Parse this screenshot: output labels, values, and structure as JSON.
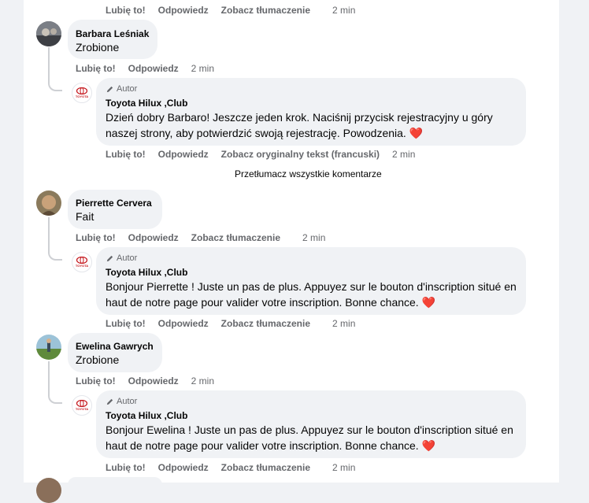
{
  "top_actions": {
    "like": "Lubię to!",
    "reply": "Odpowiedz",
    "translate": "Zobacz tłumaczenie",
    "time": "2 min"
  },
  "page_author": {
    "name": "Toyota Hilux ,Club",
    "author_badge": "Autor",
    "logo_text": "TOYOTA",
    "logo_sub": "Hilux"
  },
  "comments": [
    {
      "author": "Barbara Leśniak",
      "text": "Zrobione",
      "actions": {
        "like": "Lubię to!",
        "reply": "Odpowiedz",
        "time": "2 min"
      },
      "reply": {
        "text": "Dzień dobry Barbaro! Jeszcze jeden krok. Naciśnij przycisk rejestracyjny u góry naszej strony, aby potwierdzić swoją rejestrację. Powodzenia. ❤️",
        "actions": {
          "like": "Lubię to!",
          "reply": "Odpowiedz",
          "translate": "Zobacz oryginalny tekst (francuski)",
          "time": "2 min"
        }
      }
    },
    {
      "author": "Pierrette Cervera",
      "text": "Fait",
      "actions": {
        "like": "Lubię to!",
        "reply": "Odpowiedz",
        "translate": "Zobacz tłumaczenie",
        "time": "2 min"
      },
      "reply": {
        "text": "Bonjour Pierrette ! Juste un pas de plus. Appuyez sur le bouton d'inscription situé en haut de notre page pour valider votre inscription. Bonne chance. ❤️",
        "actions": {
          "like": "Lubię to!",
          "reply": "Odpowiedz",
          "translate": "Zobacz tłumaczenie",
          "time": "2 min"
        }
      }
    },
    {
      "author": "Ewelina Gawrych",
      "text": "Zrobione",
      "actions": {
        "like": "Lubię to!",
        "reply": "Odpowiedz",
        "time": "2 min"
      },
      "reply": {
        "text": "Bonjour Ewelina ! Juste un pas de plus. Appuyez sur le bouton d'inscription situé en haut de notre page pour valider votre inscription. Bonne chance. ❤️",
        "actions": {
          "like": "Lubię to!",
          "reply": "Odpowiedz",
          "translate": "Zobacz tłumaczenie",
          "time": "2 min"
        }
      }
    }
  ],
  "translate_all": "Przetłumacz wszystkie komentarze",
  "icons": {
    "author_badge": "pencil-icon"
  },
  "colors": {
    "background": "#f0f2f5",
    "bubble": "#f0f2f5",
    "secondary_text": "#65676b",
    "heart": "#e41e3f"
  }
}
